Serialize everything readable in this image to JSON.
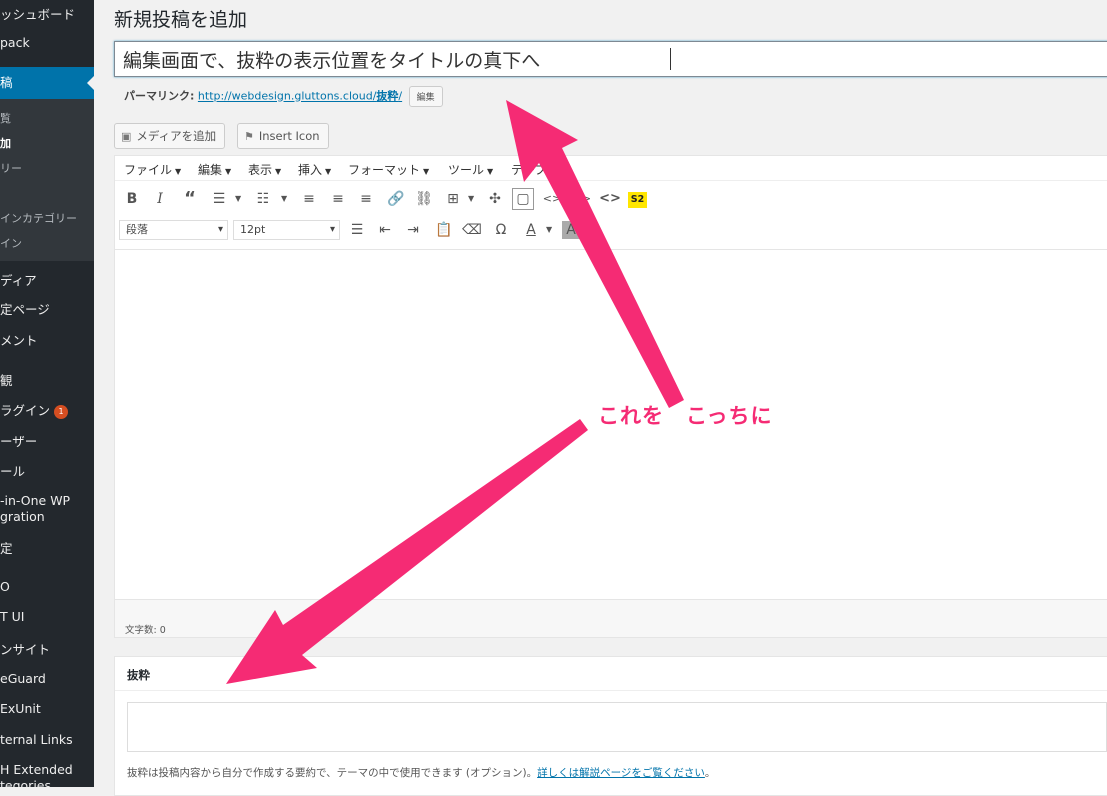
{
  "sidebar": {
    "items": [
      {
        "label": "ッシュボード"
      },
      {
        "label": "pack"
      },
      {
        "label": "稿"
      },
      {
        "label": "ディア"
      },
      {
        "label": "定ページ"
      },
      {
        "label": "メント"
      },
      {
        "label": "観"
      },
      {
        "label": "ラグイン"
      },
      {
        "label": "ーザー"
      },
      {
        "label": "ール"
      },
      {
        "label": "-in-One WP"
      },
      {
        "label": "gration"
      },
      {
        "label": "定"
      },
      {
        "label": "O"
      },
      {
        "label": "T UI"
      },
      {
        "label": "ンサイト"
      },
      {
        "label": "eGuard"
      },
      {
        "label": "ExUnit"
      },
      {
        "label": "ternal Links"
      },
      {
        "label": "H Extended"
      },
      {
        "label": "tegories"
      }
    ],
    "submenu": [
      {
        "label": "覧"
      },
      {
        "label": "加"
      },
      {
        "label": "リー"
      },
      {
        "label": "インカテゴリー"
      },
      {
        "label": "イン"
      }
    ],
    "plugin_badge": "1"
  },
  "page": {
    "title": "新規投稿を追加",
    "post_title": "編集画面で、抜粋の表示位置をタイトルの真下へ",
    "permalink_label": "パーマリンク:",
    "permalink_url_prefix": "http://webdesign.gluttons.cloud/",
    "permalink_slug": "抜粋",
    "permalink_url_suffix": "/",
    "permalink_edit": "編集"
  },
  "media_buttons": {
    "add_media": "メディアを追加",
    "insert_icon": "Insert Icon"
  },
  "editor": {
    "menubar": [
      "ファイル",
      "編集",
      "表示",
      "挿入",
      "フォーマット",
      "ツール",
      "テーブル"
    ],
    "format_select": "段落",
    "size_select": "12pt",
    "word_count": "文字数: 0",
    "s2_label": "S2"
  },
  "excerpt": {
    "title": "抜粋",
    "help_text": "抜粋は投稿内容から自分で作成する要約で、テーマの中で使用できます (オプション)。",
    "help_link": "詳しくは解説ページをご覧ください",
    "help_end": "。"
  },
  "annotation": {
    "text": "これを　こっちに",
    "color": "#f52b74"
  },
  "colors": {
    "sidebar_bg": "#23282d",
    "accent": "#0073aa"
  }
}
